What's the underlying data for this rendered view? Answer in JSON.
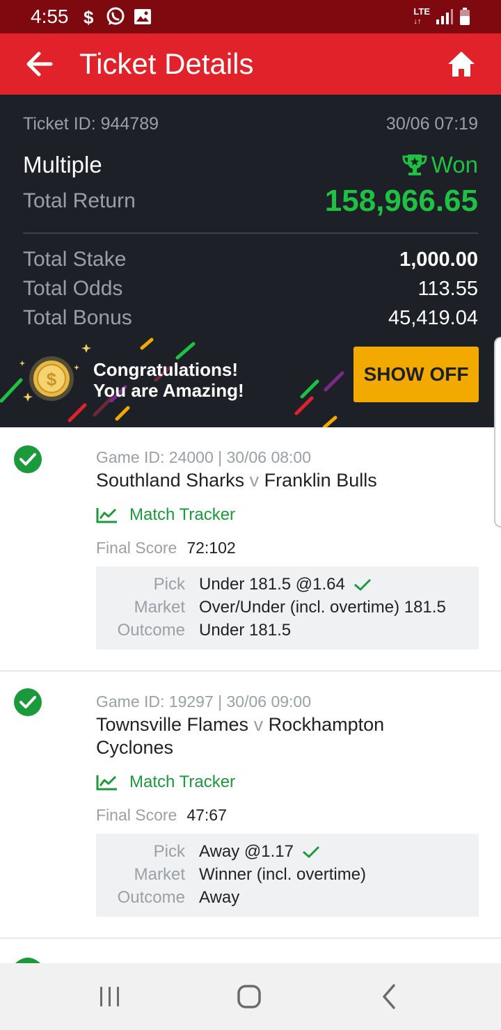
{
  "status_bar": {
    "time": "4:55",
    "network": "LTE",
    "left_icons": [
      "dollar-icon",
      "whatsapp-icon",
      "gallery-icon"
    ],
    "right_icons": [
      "lte-icon",
      "signal-icon",
      "battery-icon"
    ]
  },
  "app_bar": {
    "title": "Ticket Details",
    "back_icon": "arrow-left-icon",
    "home_icon": "home-icon",
    "color": "#e2222b"
  },
  "ticket": {
    "id_text": "Ticket ID: 944789",
    "datetime": "30/06 07:19",
    "type": "Multiple",
    "status": "Won",
    "total_return_label": "Total Return",
    "total_return": "158,966.65",
    "rows": [
      {
        "label": "Total Stake",
        "value": "1,000.00"
      },
      {
        "label": "Total Odds",
        "value": "113.55"
      },
      {
        "label": "Total Bonus",
        "value": "45,419.04"
      }
    ],
    "banner": {
      "line1": "Congratulations!",
      "line2": "You are Amazing!",
      "button": "SHOW OFF"
    },
    "colors": {
      "won": "#1ec142",
      "card_bg": "#1d2027",
      "show_off": "#f2a900"
    }
  },
  "games": [
    {
      "meta": "Game ID: 24000 | 30/06 08:00",
      "home": "Southland Sharks",
      "vs": "v",
      "away": "Franklin Bulls",
      "tracker": "Match Tracker",
      "score_label": "Final Score",
      "score": "72:102",
      "pick_label": "Pick",
      "pick": "Under 181.5 @1.64",
      "market_label": "Market",
      "market": "Over/Under (incl. overtime) 181.5",
      "outcome_label": "Outcome",
      "outcome": "Under 181.5"
    },
    {
      "meta": "Game ID: 19297 | 30/06 09:00",
      "home": "Townsville Flames",
      "vs": "v",
      "away": "Rockhampton Cyclones",
      "tracker": "Match Tracker",
      "score_label": "Final Score",
      "score": "47:67",
      "pick_label": "Pick",
      "pick": "Away @1.17",
      "market_label": "Market",
      "market": "Winner (incl. overtime)",
      "outcome_label": "Outcome",
      "outcome": "Away"
    }
  ],
  "nav_bar": {
    "icons": [
      "recent-apps-icon",
      "home-circle-icon",
      "back-chevron-icon"
    ]
  }
}
